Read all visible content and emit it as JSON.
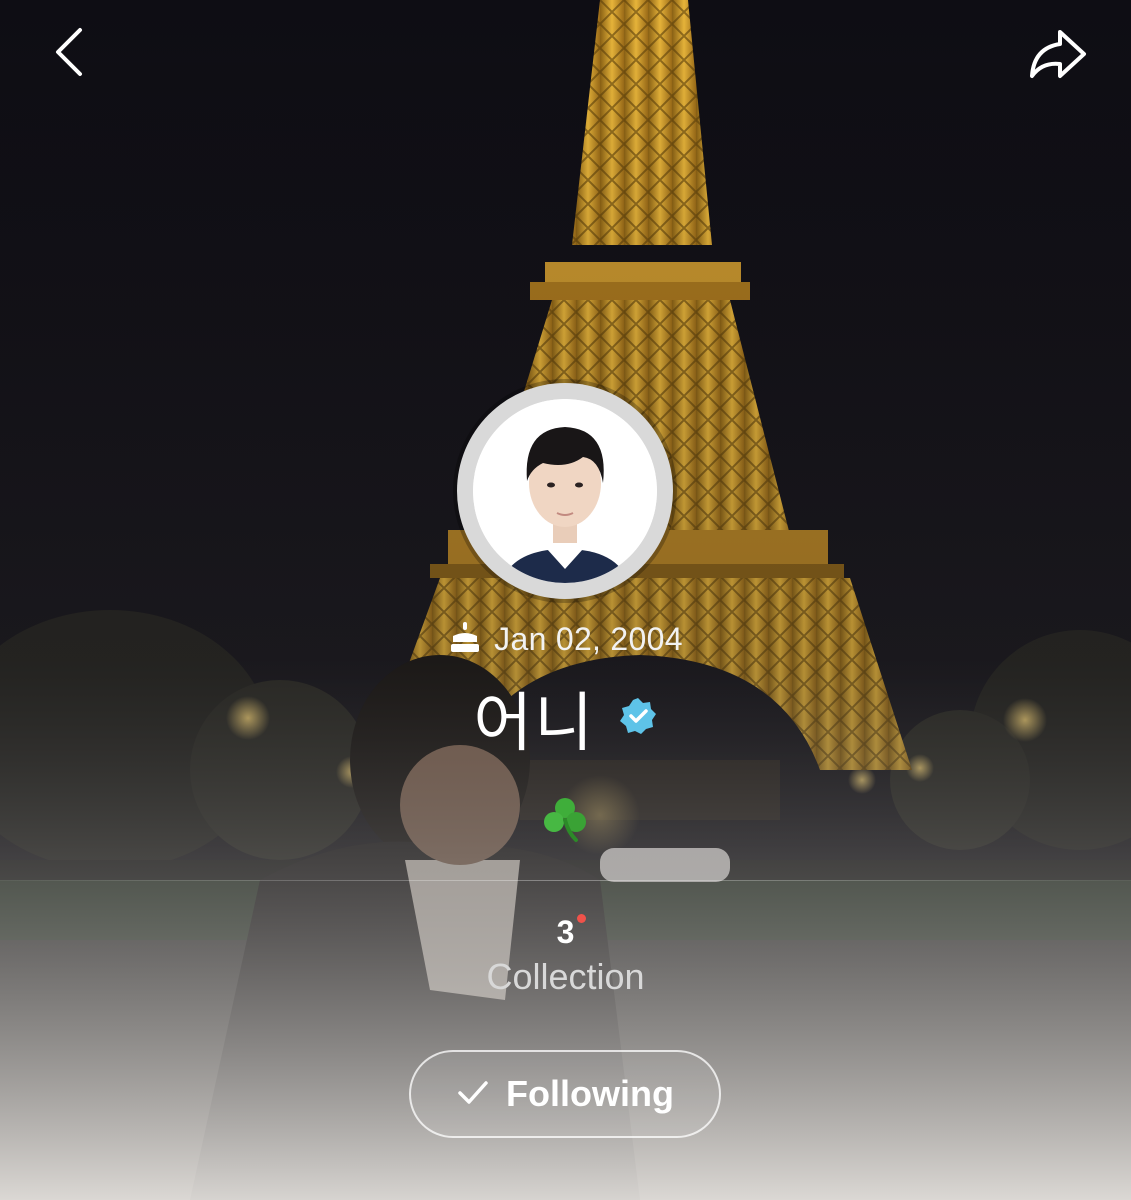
{
  "header": {
    "back_icon": "chevron-left-icon",
    "share_icon": "share-arrow-icon"
  },
  "profile": {
    "birthday_icon": "cake-icon",
    "birthday": "Jan 02, 2004",
    "name": "어니",
    "verified_icon": "verified-badge-icon",
    "status_emoji_icon": "shamrock-icon"
  },
  "stats": {
    "collection_count": "3",
    "collection_label": "Collection",
    "has_new_dot": true
  },
  "follow_button": {
    "label": "Following",
    "icon": "checkmark-icon"
  },
  "colors": {
    "accent_verified": "#5ec3e8",
    "new_dot": "#f0524a",
    "text_primary": "#ffffff",
    "tower_gold": "#d9a42a"
  }
}
